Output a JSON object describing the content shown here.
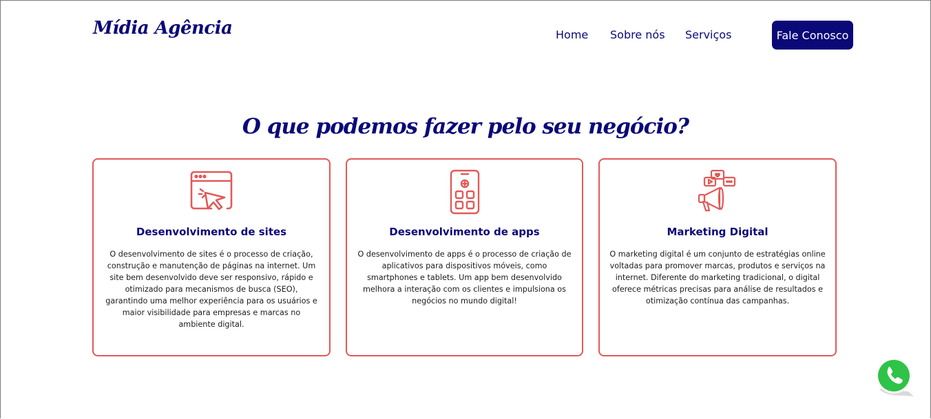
{
  "header": {
    "logo": "Mídia Agência",
    "nav": [
      "Home",
      "Sobre nós",
      "Serviços"
    ],
    "cta": "Fale Conosco"
  },
  "section": {
    "title": "O que podemos fazer pelo seu negócio?",
    "cards": [
      {
        "icon": "web-click-icon",
        "title": "Desenvolvimento de sites",
        "text": "O desenvolvimento de sites é o processo de criação, construção e manutenção de páginas na internet. Um site bem desenvolvido deve ser responsivo, rápido e otimizado para mecanismos de busca (SEO), garantindo uma melhor experiência para os usuários e maior visibilidade para empresas e marcas no ambiente digital."
      },
      {
        "icon": "mobile-apps-icon",
        "title": "Desenvolvimento de apps",
        "text": "O desenvolvimento de apps é o processo de criação de aplicativos para dispositivos móveis, como smartphones e tablets. Um app bem desenvolvido melhora a interação com os clientes e impulsiona os negócios no mundo digital!"
      },
      {
        "icon": "megaphone-social-icon",
        "title": "Marketing Digital",
        "text": "O marketing digital é um conjunto de estratégias online voltadas para promover marcas, produtos e serviços na internet. Diferente do marketing tradicional, o digital oferece métricas precisas para análise de resultados e otimização contínua das campanhas."
      }
    ]
  },
  "floating": {
    "icon": "whatsapp-icon"
  },
  "colors": {
    "primary": "#0b0878",
    "accent": "#e05a59",
    "whatsapp": "#2fc347"
  }
}
